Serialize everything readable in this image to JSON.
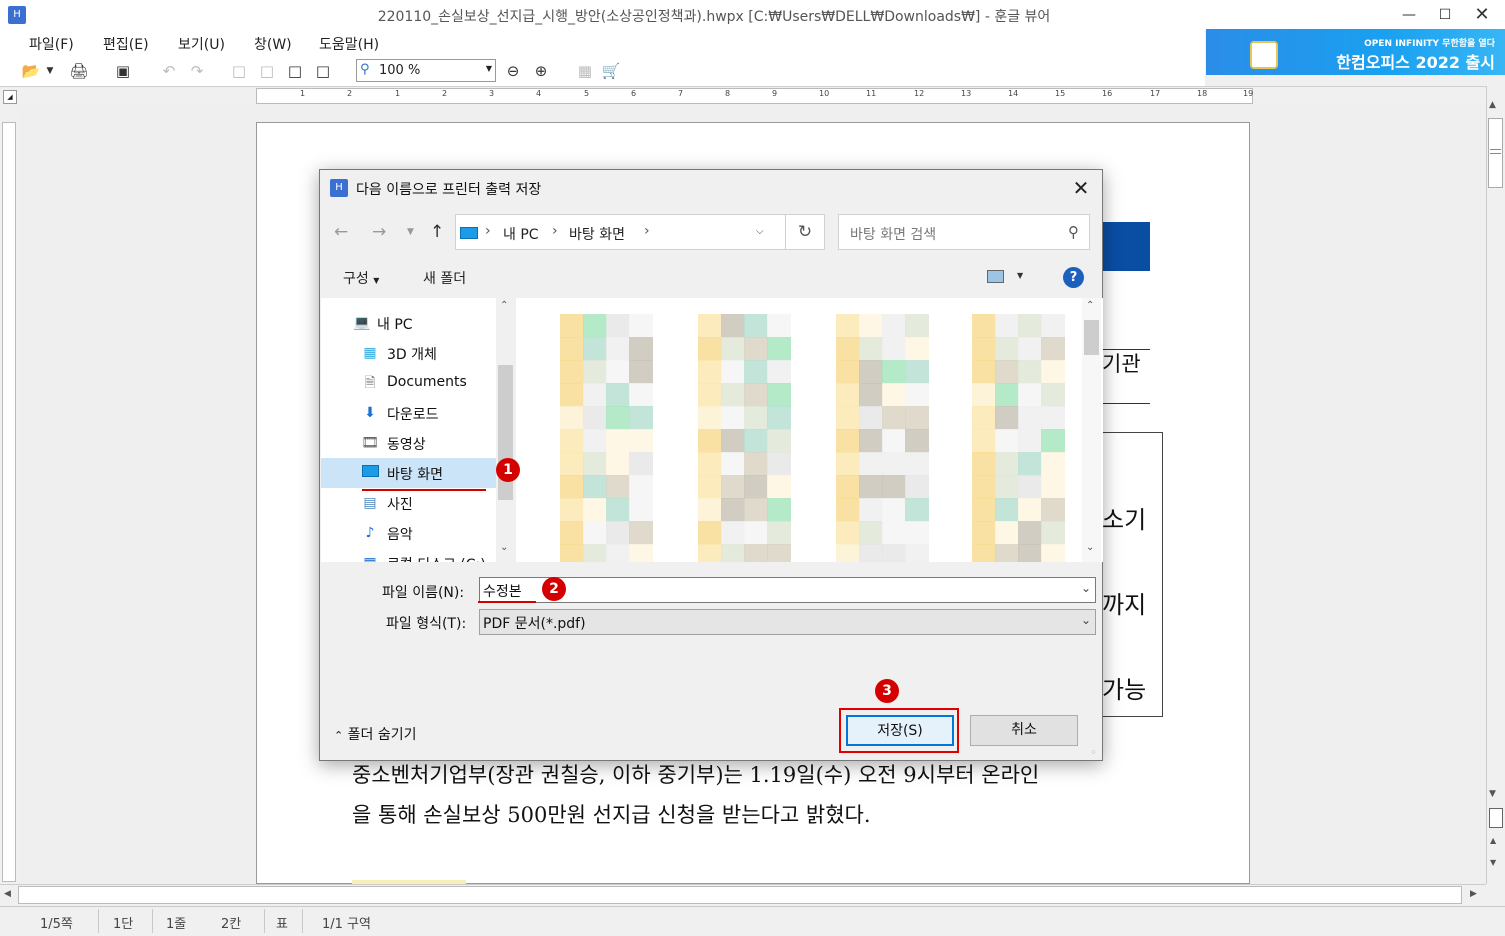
{
  "window": {
    "title": "220110_손실보상_선지급_시행_방안(소상공인정책과).hwpx [C:₩Users₩DELL₩Downloads₩] - 훈글 뷰어"
  },
  "menu": [
    "파일(F)",
    "편집(E)",
    "보기(U)",
    "창(W)",
    "도움말(H)"
  ],
  "banner": {
    "line1": "OPEN INFINITY 무한함을 열다",
    "line2": "한컴오피스 2022 출시"
  },
  "toolbar": {
    "zoom": "100 %"
  },
  "ruler_labels": [
    "1",
    "2",
    "1",
    "2",
    "3",
    "4",
    "5",
    "6",
    "7",
    "8",
    "9",
    "10",
    "11",
    "12",
    "13",
    "14",
    "15",
    "16",
    "17",
    "18",
    "19"
  ],
  "document": {
    "frag_1": "기관",
    "frag_2": "소기",
    "frag_3": "까지",
    "frag_4": "가능",
    "para_line1": "중소벤처기업부(장관 권칠승, 이하 중기부)는 1.19일(수) 오전 9시부터 온라인",
    "para_line2": "을 통해 손실보상 500만원 선지급 신청을 받는다고 밝혔다."
  },
  "status": {
    "page": "1/5쪽",
    "column": "1단",
    "line": "1줄",
    "col": "2칸",
    "table": "표",
    "section": "1/1 구역"
  },
  "dialog": {
    "title": "다음 이름으로 프린터 출력 저장",
    "breadcrumb": [
      "내 PC",
      "바탕 화면"
    ],
    "search_placeholder": "바탕 화면 검색",
    "organize": "구성",
    "new_folder": "새 폴더",
    "help": "?",
    "nav_items": [
      {
        "label": "내 PC",
        "icon": "computer-icon"
      },
      {
        "label": "3D 개체",
        "icon": "3d-objects-icon"
      },
      {
        "label": "Documents",
        "icon": "documents-icon"
      },
      {
        "label": "다운로드",
        "icon": "download-icon"
      },
      {
        "label": "동영상",
        "icon": "video-icon"
      },
      {
        "label": "바탕 화면",
        "icon": "desktop-icon"
      },
      {
        "label": "사진",
        "icon": "pictures-icon"
      },
      {
        "label": "음악",
        "icon": "music-icon"
      },
      {
        "label": "로컬 디스크 (C:)",
        "icon": "disk-icon"
      }
    ],
    "file_name_label": "파일 이름(N):",
    "file_name_value": "수정본",
    "file_type_label": "파일 형식(T):",
    "file_type_value": "PDF 문서(*.pdf)",
    "hide_folders": "폴더 숨기기",
    "save": "저장(S)",
    "cancel": "취소"
  },
  "annotations": {
    "step1": "1",
    "step2": "2",
    "step3": "3"
  },
  "colors": {
    "accent": "#0078d7",
    "annotation_red": "#d40000",
    "doc_blue": "#0a4ea4",
    "nav_selected": "#cce4f7"
  }
}
